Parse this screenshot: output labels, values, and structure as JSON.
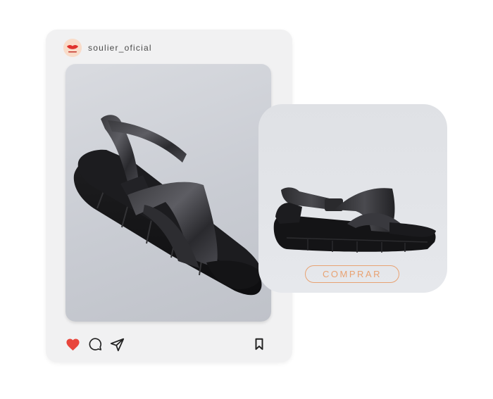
{
  "post": {
    "username": "soulier_oficial",
    "avatar_icon": "lips-logo-icon",
    "actions": {
      "like_icon": "heart-icon",
      "like_color": "#e8453c",
      "comment_icon": "comment-bubble-icon",
      "share_icon": "send-arrow-icon",
      "save_icon": "bookmark-icon"
    }
  },
  "product": {
    "buy_label": "COMPRAR",
    "accent_color": "#e8a272"
  }
}
